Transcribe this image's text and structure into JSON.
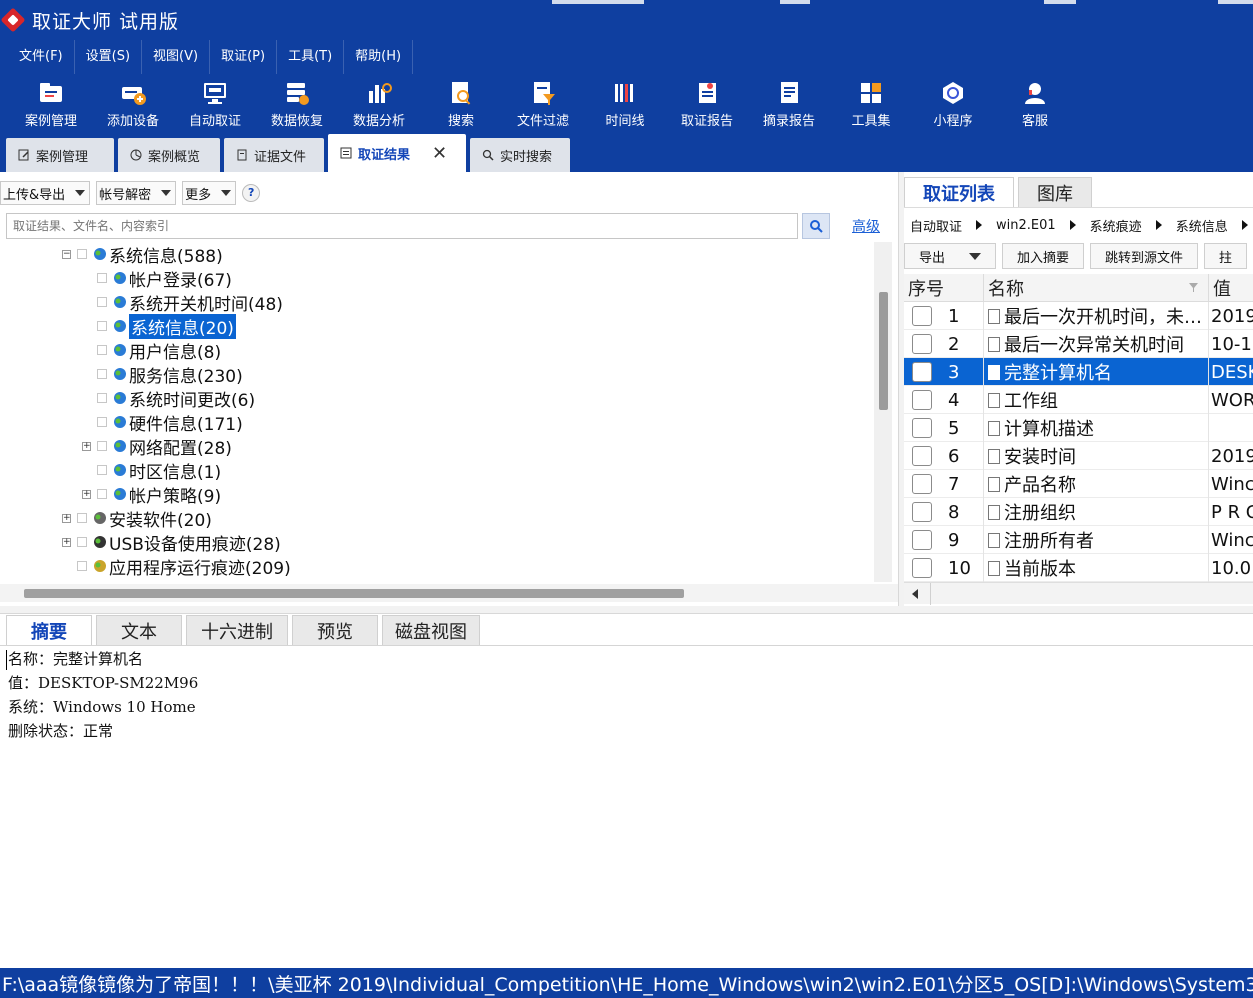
{
  "window": {
    "title": "取证大师 试用版"
  },
  "menu": [
    "文件(F)",
    "设置(S)",
    "视图(V)",
    "取证(P)",
    "工具(T)",
    "帮助(H)"
  ],
  "toolbar": [
    {
      "label": "案例管理",
      "icon": "folder-icon"
    },
    {
      "label": "添加设备",
      "icon": "add-device-icon"
    },
    {
      "label": "自动取证",
      "icon": "auto-monitor-icon"
    },
    {
      "label": "数据恢复",
      "icon": "data-recovery-icon"
    },
    {
      "label": "数据分析",
      "icon": "bar-chart-icon"
    },
    {
      "label": "搜索",
      "icon": "search-doc-icon"
    },
    {
      "label": "文件过滤",
      "icon": "filter-icon"
    },
    {
      "label": "时间线",
      "icon": "timeline-icon"
    },
    {
      "label": "取证报告",
      "icon": "report-icon"
    },
    {
      "label": "摘录报告",
      "icon": "excerpt-icon"
    },
    {
      "label": "工具集",
      "icon": "grid-icon"
    },
    {
      "label": "小程序",
      "icon": "mini-program-icon"
    },
    {
      "label": "客服",
      "icon": "support-agent-icon"
    }
  ],
  "doc_tabs": [
    {
      "label": "案例管理",
      "icon": "edit-icon"
    },
    {
      "label": "案例概览",
      "icon": "pie-icon"
    },
    {
      "label": "证据文件",
      "icon": "file-icon"
    },
    {
      "label": "取证结果",
      "icon": "result-icon",
      "active": true,
      "closable": true
    },
    {
      "label": "实时搜索",
      "icon": "search-icon"
    }
  ],
  "left": {
    "dropdowns": [
      "上传&导出",
      "帐号解密",
      "更多"
    ],
    "help": "?",
    "search_placeholder": "取证结果、文件名、内容索引",
    "advanced": "高级",
    "tree": [
      {
        "label": "系统信息(588)",
        "indent": 1,
        "expander": "minus",
        "icon": "globe-icon"
      },
      {
        "label": "帐户登录(67)",
        "indent": 2,
        "expander": "",
        "icon": "globe-icon"
      },
      {
        "label": "系统开关机时间(48)",
        "indent": 2,
        "expander": "",
        "icon": "globe-icon"
      },
      {
        "label": "系统信息(20)",
        "indent": 2,
        "expander": "",
        "icon": "globe-icon",
        "selected": true
      },
      {
        "label": "用户信息(8)",
        "indent": 2,
        "expander": "",
        "icon": "globe-icon"
      },
      {
        "label": "服务信息(230)",
        "indent": 2,
        "expander": "",
        "icon": "globe-icon"
      },
      {
        "label": "系统时间更改(6)",
        "indent": 2,
        "expander": "",
        "icon": "globe-icon"
      },
      {
        "label": "硬件信息(171)",
        "indent": 2,
        "expander": "",
        "icon": "globe-icon"
      },
      {
        "label": "网络配置(28)",
        "indent": 2,
        "expander": "plus",
        "icon": "globe-icon"
      },
      {
        "label": "时区信息(1)",
        "indent": 2,
        "expander": "",
        "icon": "globe-icon"
      },
      {
        "label": "帐户策略(9)",
        "indent": 2,
        "expander": "plus",
        "icon": "globe-icon"
      },
      {
        "label": "安装软件(20)",
        "indent": 1,
        "expander": "plus",
        "icon": "install-icon"
      },
      {
        "label": "USB设备使用痕迹(28)",
        "indent": 1,
        "expander": "plus",
        "icon": "usb-icon"
      },
      {
        "label": "应用程序运行痕迹(209)",
        "indent": 1,
        "expander": "",
        "icon": "app-icon"
      }
    ]
  },
  "right": {
    "tabs": [
      {
        "label": "取证列表",
        "active": true
      },
      {
        "label": "图库",
        "active": false
      }
    ],
    "breadcrumb": [
      "自动取证",
      "win2.E01",
      "系统痕迹",
      "系统信息"
    ],
    "buttons": {
      "export": "导出",
      "add_summary": "加入摘要",
      "jump": "跳转到源文件",
      "extra": "拄"
    },
    "columns": [
      "序号",
      "名称",
      "值"
    ],
    "rows": [
      {
        "no": "1",
        "name": "最后一次开机时间，未…",
        "value": "2019"
      },
      {
        "no": "2",
        "name": "最后一次异常关机时间",
        "value": "10-1"
      },
      {
        "no": "3",
        "name": "完整计算机名",
        "value": "DESK",
        "selected": true
      },
      {
        "no": "4",
        "name": "工作组",
        "value": "WOR"
      },
      {
        "no": "5",
        "name": "计算机描述",
        "value": ""
      },
      {
        "no": "6",
        "name": "安装时间",
        "value": "2019"
      },
      {
        "no": "7",
        "name": "产品名称",
        "value": "Winc"
      },
      {
        "no": "8",
        "name": "注册组织",
        "value": "P R C"
      },
      {
        "no": "9",
        "name": "注册所有者",
        "value": "Winc"
      },
      {
        "no": "10",
        "name": "当前版本",
        "value": "10.0"
      }
    ]
  },
  "bottom": {
    "tabs": [
      {
        "label": "摘要",
        "active": true
      },
      {
        "label": "文本",
        "active": false
      },
      {
        "label": "十六进制",
        "active": false
      },
      {
        "label": "预览",
        "active": false
      },
      {
        "label": "磁盘视图",
        "active": false
      }
    ],
    "summary_lines": [
      "名称：完整计算机名",
      "值：DESKTOP-SM22M96",
      "系统：Windows 10 Home",
      "删除状态：正常"
    ]
  },
  "status": "F:\\aaa镜像镜像为了帝国！！！\\美亚杯 2019\\Individual_Competition\\HE_Home_Windows\\win2\\win2.E01\\分区5_OS[D]:\\Windows\\System32\\",
  "colors": {
    "brand": "#0f3fa0",
    "selected": "#0a64d2",
    "accent_red": "#d8262a",
    "link": "#1b5fd6"
  }
}
